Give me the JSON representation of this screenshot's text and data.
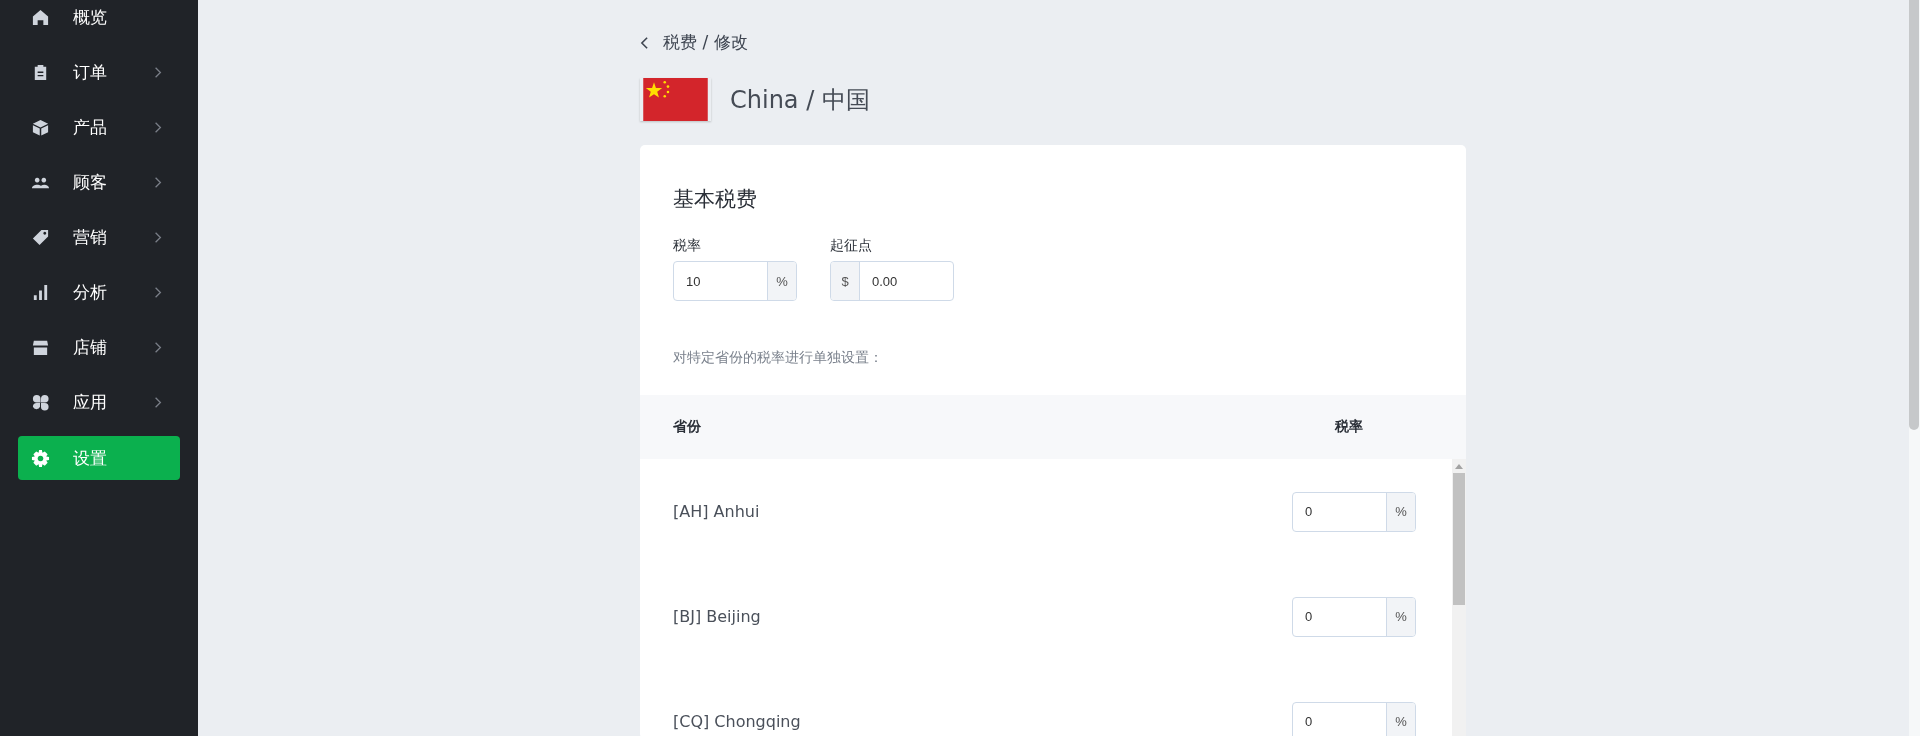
{
  "sidebar": {
    "items": [
      {
        "label": "概览",
        "has_submenu": false,
        "selected": false
      },
      {
        "label": "订单",
        "has_submenu": true,
        "selected": false
      },
      {
        "label": "产品",
        "has_submenu": true,
        "selected": false
      },
      {
        "label": "顾客",
        "has_submenu": true,
        "selected": false
      },
      {
        "label": "营销",
        "has_submenu": true,
        "selected": false
      },
      {
        "label": "分析",
        "has_submenu": true,
        "selected": false
      },
      {
        "label": "店铺",
        "has_submenu": true,
        "selected": false
      },
      {
        "label": "应用",
        "has_submenu": true,
        "selected": false
      },
      {
        "label": "设置",
        "has_submenu": false,
        "selected": true
      }
    ]
  },
  "breadcrumb": "税费 / 修改",
  "country": {
    "name": "China / 中国"
  },
  "base_tax": {
    "title": "基本税费",
    "rate": {
      "label": "税率",
      "value": "10",
      "suffix": "%"
    },
    "threshold": {
      "label": "起征点",
      "prefix": "$",
      "value": "0.00"
    }
  },
  "provinces": {
    "hint": "对特定省份的税率进行单独设置：",
    "columns": [
      "省份",
      "税率"
    ],
    "rows": [
      {
        "name": "[AH] Anhui",
        "value": "0",
        "suffix": "%"
      },
      {
        "name": "[BJ] Beijing",
        "value": "0",
        "suffix": "%"
      },
      {
        "name": "[CQ] Chongqing",
        "value": "0",
        "suffix": "%"
      }
    ]
  }
}
